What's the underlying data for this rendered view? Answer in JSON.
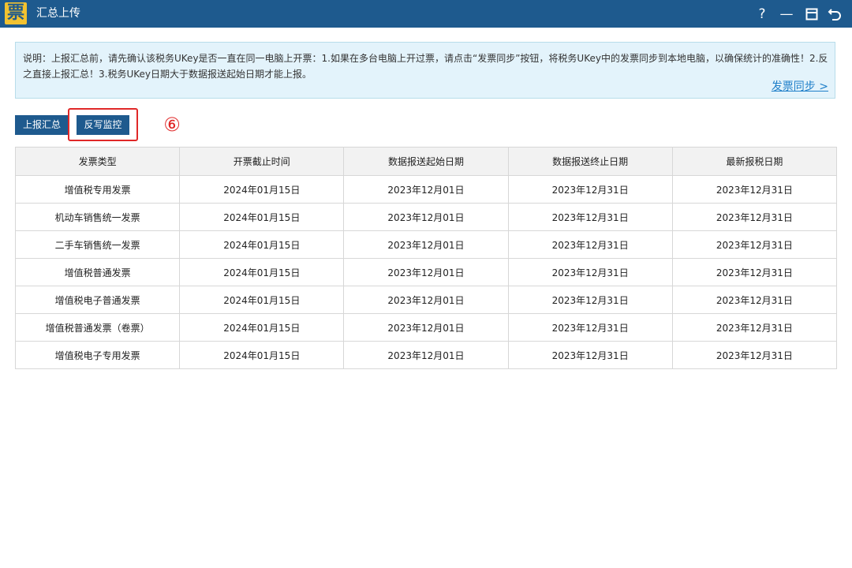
{
  "window": {
    "title": "汇总上传",
    "logo_glyph": "票",
    "controls": {
      "help": "?",
      "minimize": "—",
      "maximize": "□",
      "back": "↶"
    }
  },
  "notice": {
    "text": "说明：上报汇总前，请先确认该税务UKey是否一直在同一电脑上开票：1.如果在多台电脑上开过票，请点击“发票同步”按钮，将税务UKey中的发票同步到本地电脑，以确保统计的准确性！2.反之直接上报汇总！3.税务UKey日期大于数据报送起始日期才能上报。",
    "link": "发票同步 >"
  },
  "toolbar": {
    "report_label": "上报汇总",
    "rewrite_label": "反写监控",
    "step_marker": "⑥"
  },
  "colors": {
    "titlebar": "#1e5a8e",
    "button": "#1e5a8e",
    "highlight": "#e02828",
    "notice_bg": "#e3f3fb",
    "link": "#1f7fc9"
  },
  "table": {
    "headers": [
      "发票类型",
      "开票截止时间",
      "数据报送起始日期",
      "数据报送终止日期",
      "最新报税日期"
    ],
    "rows": [
      [
        "增值税专用发票",
        "2024年01月15日",
        "2023年12月01日",
        "2023年12月31日",
        "2023年12月31日"
      ],
      [
        "机动车销售统一发票",
        "2024年01月15日",
        "2023年12月01日",
        "2023年12月31日",
        "2023年12月31日"
      ],
      [
        "二手车销售统一发票",
        "2024年01月15日",
        "2023年12月01日",
        "2023年12月31日",
        "2023年12月31日"
      ],
      [
        "增值税普通发票",
        "2024年01月15日",
        "2023年12月01日",
        "2023年12月31日",
        "2023年12月31日"
      ],
      [
        "增值税电子普通发票",
        "2024年01月15日",
        "2023年12月01日",
        "2023年12月31日",
        "2023年12月31日"
      ],
      [
        "增值税普通发票（卷票）",
        "2024年01月15日",
        "2023年12月01日",
        "2023年12月31日",
        "2023年12月31日"
      ],
      [
        "增值税电子专用发票",
        "2024年01月15日",
        "2023年12月01日",
        "2023年12月31日",
        "2023年12月31日"
      ]
    ]
  }
}
